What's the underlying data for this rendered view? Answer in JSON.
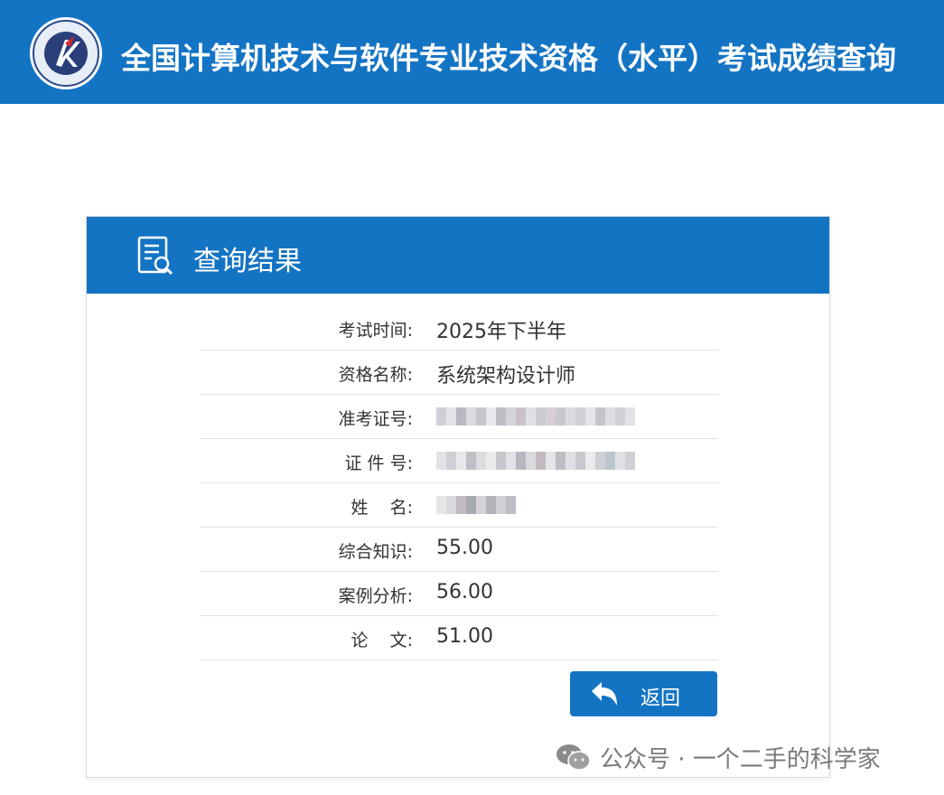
{
  "header": {
    "title": "全国计算机技术与软件专业技术资格（水平）考试成绩查询"
  },
  "card": {
    "title": "查询结果",
    "rows": [
      {
        "label": "考试时间:",
        "value": "2025年下半年"
      },
      {
        "label": "资格名称:",
        "value": "系统架构设计师"
      },
      {
        "label": "准考证号:",
        "value": ""
      },
      {
        "label": "证 件 号:",
        "value": ""
      },
      {
        "label": "姓    名:",
        "value": ""
      },
      {
        "label": "综合知识:",
        "value": "55.00"
      },
      {
        "label": "案例分析:",
        "value": "56.00"
      },
      {
        "label": "论    文:",
        "value": "51.00"
      }
    ],
    "back_label": "返回"
  },
  "watermark": {
    "text": "公众号 · 一个二手的科学家"
  },
  "colors": {
    "brand": "#1474c4",
    "text": "#333333"
  },
  "icons": {
    "logo": "exam-seal-logo",
    "header": "document-search-icon",
    "back": "return-arrow-icon",
    "watermark": "wechat-icon"
  }
}
